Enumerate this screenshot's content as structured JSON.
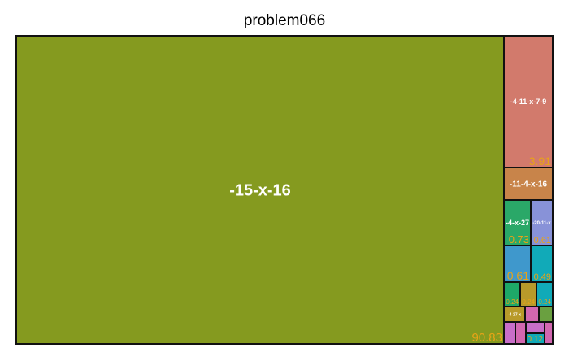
{
  "chart_data": {
    "type": "treemap",
    "title": "problem066",
    "items": [
      {
        "label": "-15-x-16",
        "value": 90.83,
        "value_text": "90.83",
        "color": "#859a1f"
      },
      {
        "label": "-4-11-x-7-9",
        "value": 3.91,
        "value_text": "3.91",
        "color": "#d27a6c"
      },
      {
        "label": "-11-4-x-16",
        "value": 1.29,
        "value_text": "",
        "color": "#c8844a"
      },
      {
        "label": "-4-x-27",
        "value": 0.73,
        "value_text": "0.73",
        "color": "#2aa868"
      },
      {
        "label": "-20-11-x",
        "value": 0.61,
        "value_text": "0.61",
        "color": "#8892d8"
      },
      {
        "label": "",
        "value": 0.61,
        "value_text": "0.61",
        "color": "#3f98cc"
      },
      {
        "label": "",
        "value": 0.49,
        "value_text": "0.49",
        "color": "#11aab8"
      },
      {
        "label": "",
        "value": 0.24,
        "value_text": "0.24",
        "color": "#1ea868"
      },
      {
        "label": "",
        "value": 0.24,
        "value_text": "0.24",
        "color": "#b89a2a"
      },
      {
        "label": "",
        "value": 0.24,
        "value_text": "0.24",
        "color": "#11aab8"
      },
      {
        "label": "-4-27-x",
        "value": 0.12,
        "value_text": "",
        "color": "#b89a2a"
      },
      {
        "label": "",
        "value": 0.12,
        "value_text": "",
        "color": "#d267b0"
      },
      {
        "label": "",
        "value": 0.12,
        "value_text": "",
        "color": "#6aa040"
      },
      {
        "label": "",
        "value": 0.12,
        "value_text": "",
        "color": "#c86ec8"
      },
      {
        "label": "",
        "value": 0.12,
        "value_text": "",
        "color": "#d267b0"
      },
      {
        "label": "",
        "value": 0.12,
        "value_text": "",
        "color": "#c86ec8"
      },
      {
        "label": "",
        "value": 0.12,
        "value_text": "0.12",
        "color": "#11aab8"
      },
      {
        "label": "",
        "value": 0.12,
        "value_text": "",
        "color": "#d267b0"
      }
    ]
  }
}
